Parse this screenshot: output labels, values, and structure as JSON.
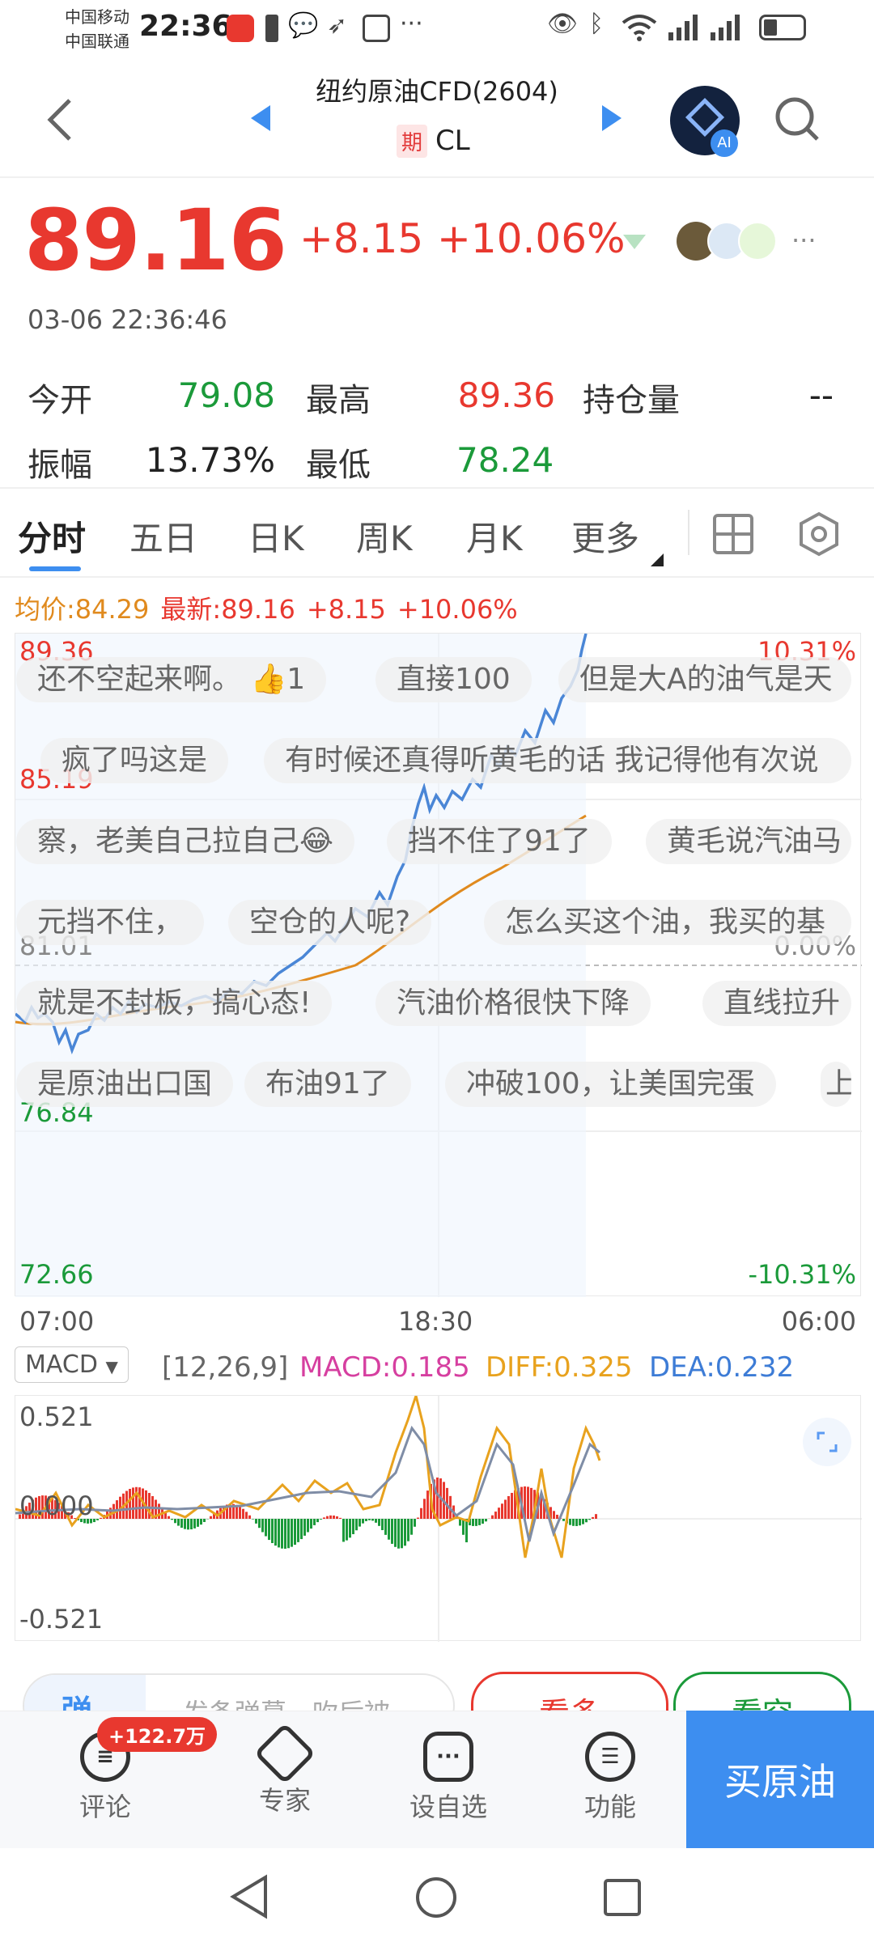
{
  "status_bar": {
    "carrier1": "中国移动",
    "carrier2": "中国联通",
    "time": "22:36",
    "more": "···"
  },
  "header": {
    "title": "纽约原油CFD(2604)",
    "tag": "期",
    "symbol": "CL",
    "ai_label": "AI"
  },
  "quote": {
    "price": "89.16",
    "change": "+8.15",
    "change_pct": "+10.06%",
    "datetime": "03-06 22:36:46",
    "more": "···"
  },
  "stats": [
    {
      "label": "今开",
      "value": "79.08",
      "color": "green"
    },
    {
      "label": "最高",
      "value": "89.36",
      "color": "red"
    },
    {
      "label": "持仓量",
      "value": "--",
      "color": "dark"
    },
    {
      "label": "振幅",
      "value": "13.73%",
      "color": "dark"
    },
    {
      "label": "最低",
      "value": "78.24",
      "color": "green"
    }
  ],
  "tabs": [
    "分时",
    "五日",
    "日K",
    "周K",
    "月K",
    "更多"
  ],
  "active_tab": "分时",
  "info_row": {
    "avg": "均价:84.29",
    "latest": "最新:89.16",
    "change": "+8.15",
    "change_pct": "+10.06%"
  },
  "chart_axes": {
    "y_left": [
      "89.36",
      "85.19",
      "81.01",
      "76.84",
      "72.66"
    ],
    "y_right": [
      "10.31%",
      "0.00%",
      "-10.31%"
    ],
    "x": [
      "07:00",
      "18:30",
      "06:00"
    ]
  },
  "danmu": [
    "还不空起来啊。 👍1",
    "直接100",
    "但是大A的油气是天",
    "疯了吗这是",
    "有时候还真得听黄毛的话 我记得他有次说",
    "察，老美自己拉自己😂",
    "挡不住了91了",
    "黄毛说汽油马",
    "元挡不住，",
    "空仓的人呢?",
    "怎么买这个油，我买的基",
    "就是不封板，搞心态!",
    "汽油价格很快下降",
    "直线拉升",
    "是原油出口国",
    "布油91了",
    "冲破100，让美国完蛋",
    "上"
  ],
  "macd": {
    "selector": "MACD",
    "params": "[12,26,9]",
    "macd": "MACD:0.185",
    "diff": "DIFF:0.325",
    "dea": "DEA:0.232",
    "y_labels": [
      "0.521",
      "0.000",
      "-0.521"
    ]
  },
  "comment_bar": {
    "left_char": "弹",
    "placeholder": "发条弹幕，吹后被",
    "btn1": "看多",
    "btn2": "看空"
  },
  "bottom_nav": {
    "badge": "+122.7万",
    "items": [
      "评论",
      "专家",
      "设自选",
      "功能"
    ],
    "buy": "买原油"
  },
  "colors": {
    "up": "#e8382f",
    "down": "#1b9a3a",
    "line": "#4a86d6",
    "avg": "#e08a1e",
    "accent": "#3d8ef0"
  }
}
